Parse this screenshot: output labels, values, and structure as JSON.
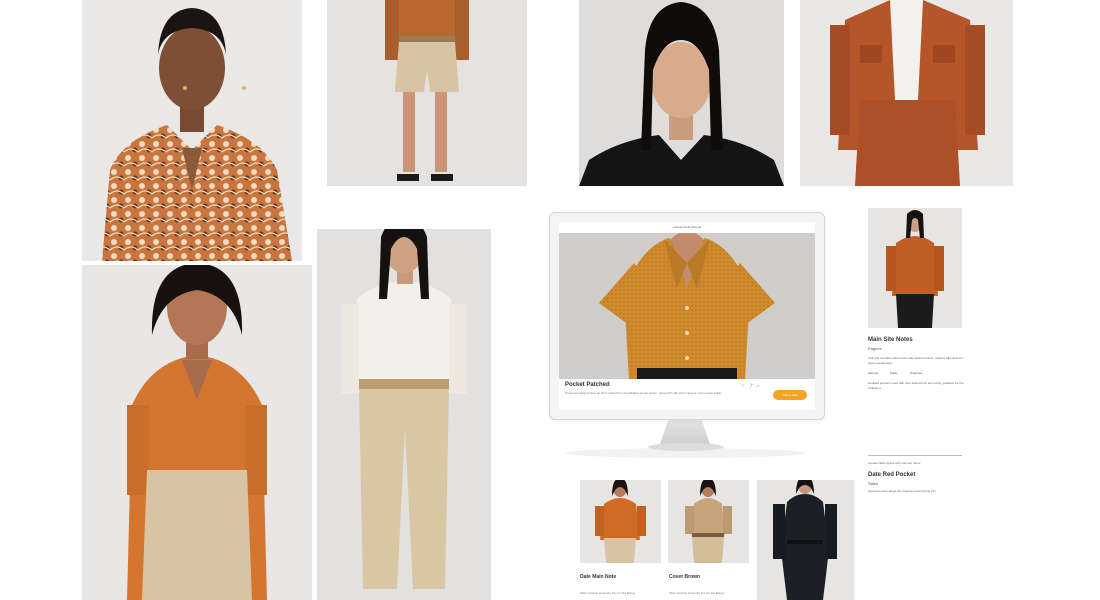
{
  "monitor": {
    "top_label": "Casual Outfit Sample",
    "product_title": "Pocket Patched",
    "product_desc": "Textured orange button-up shirt crafted from breathable woven cotton, relaxed fit with short sleeves and a camp collar.",
    "action_icons": [
      "heart-icon",
      "share-icon",
      "search-icon"
    ],
    "cta_label": "Add to Cart",
    "accent_color": "#f4a425"
  },
  "detail_panel": {
    "title": "Main Site Notes",
    "subtitle": "Pagees",
    "description": "Soft rust overshirt paired with wide black trousers, relaxed silhouette for warm casual days.",
    "meta": [
      "Sample",
      "Made",
      "Ordersee"
    ],
    "description2": "Detailed product notes with care instructions and sizing guidance for the collection.",
    "section2_text": "Crease fabric styles with summer tones",
    "section2_title": "Date Red Pocket",
    "section2_sub": "Sales",
    "section2_desc": "Selected notes about the collection and pricing info."
  },
  "thumbnails": [
    {
      "caption": "Date Main Note",
      "text": "Short product summary line for the listing."
    },
    {
      "caption": "Cover Brown",
      "text": "Short product summary line for the listing."
    }
  ]
}
